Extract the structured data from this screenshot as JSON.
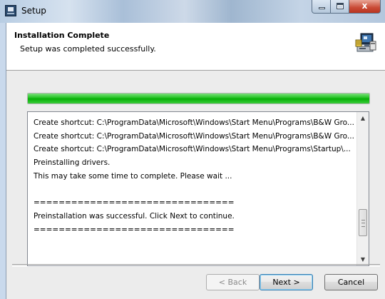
{
  "window": {
    "title": "Setup"
  },
  "header": {
    "title": "Installation Complete",
    "subtitle": "Setup was completed successfully."
  },
  "progress": {
    "value": 1.0
  },
  "log": {
    "lines": [
      "Create shortcut: C:\\ProgramData\\Microsoft\\Windows\\Start Menu\\Programs\\B&W Gro...",
      "Create shortcut: C:\\ProgramData\\Microsoft\\Windows\\Start Menu\\Programs\\B&W Gro...",
      "Create shortcut: C:\\ProgramData\\Microsoft\\Windows\\Start Menu\\Programs\\Startup\\...",
      "Preinstalling drivers.",
      "This may take some time to complete. Please wait ...",
      "",
      "================================",
      "Preinstallation was successful. Click Next to continue.",
      "================================"
    ]
  },
  "buttons": {
    "back": "< Back",
    "next": "Next >",
    "cancel": "Cancel"
  },
  "icons": {
    "app": "setup-app-icon",
    "header": "installer-computer-icon"
  },
  "colors": {
    "progress": "#06b006",
    "close": "#c94a35"
  }
}
